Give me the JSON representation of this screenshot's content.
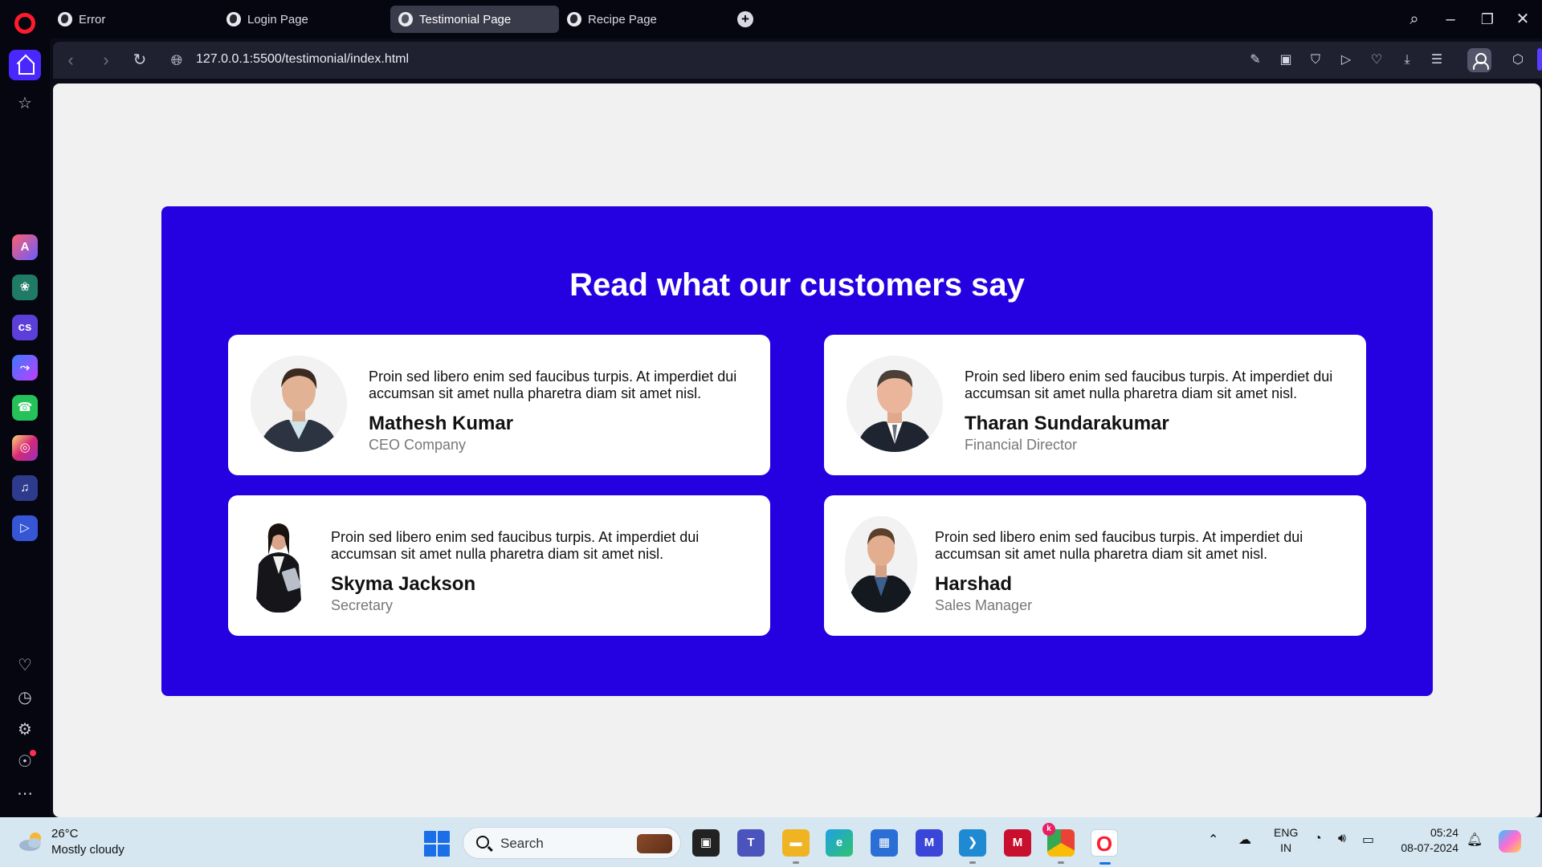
{
  "browser": {
    "tabs": [
      {
        "label": "Error"
      },
      {
        "label": "Login Page"
      },
      {
        "label": "Testimonial Page"
      },
      {
        "label": "Recipe Page"
      }
    ],
    "active_tab": 2,
    "url": "127.0.0.1:5500/testimonial/index.html"
  },
  "page": {
    "section_title": "Read what our customers say",
    "accent_color": "#2500e0",
    "testimonials": [
      {
        "quote": "Proin sed libero enim sed faucibus turpis. At imperdiet dui accumsan sit amet nulla pharetra diam sit amet nisl.",
        "name": "Mathesh Kumar",
        "role": "CEO Company"
      },
      {
        "quote": "Proin sed libero enim sed faucibus turpis. At imperdiet dui accumsan sit amet nulla pharetra diam sit amet nisl.",
        "name": "Tharan Sundarakumar",
        "role": "Financial Director"
      },
      {
        "quote": "Proin sed libero enim sed faucibus turpis. At imperdiet dui accumsan sit amet nulla pharetra diam sit amet nisl.",
        "name": "Skyma Jackson",
        "role": "Secretary"
      },
      {
        "quote": "Proin sed libero enim sed faucibus turpis. At imperdiet dui accumsan sit amet nulla pharetra diam sit amet nisl.",
        "name": "Harshad",
        "role": "Sales Manager"
      }
    ]
  },
  "sidebar_apps": [
    "aria",
    "chatgpt",
    "cs",
    "messenger",
    "whatsapp",
    "instagram",
    "music",
    "player"
  ],
  "taskbar": {
    "weather_temp": "26°C",
    "weather_desc": "Mostly cloudy",
    "search_label": "Search",
    "lang_line1": "ENG",
    "lang_line2": "IN",
    "time": "05:24",
    "date": "08-07-2024",
    "badge": "k"
  }
}
